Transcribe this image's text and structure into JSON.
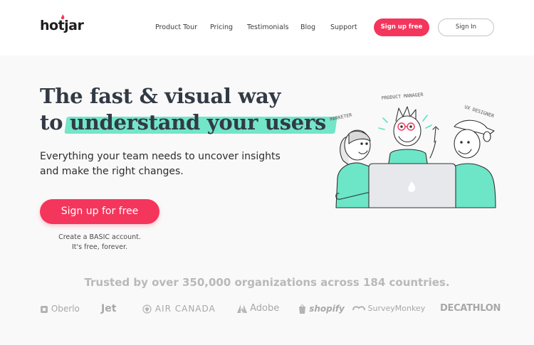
{
  "brand": {
    "logo_text": "hotjar"
  },
  "nav": {
    "items": [
      {
        "label": "Product Tour"
      },
      {
        "label": "Pricing"
      },
      {
        "label": "Testimonials"
      },
      {
        "label": "Blog"
      },
      {
        "label": "Support"
      }
    ],
    "signup_label": "Sign up free",
    "signin_label": "Sign In"
  },
  "hero": {
    "headline_line1": "The fast & visual way",
    "headline_to": "to",
    "headline_highlight": "understand your users",
    "subtitle": "Everything your team needs to uncover insights and make the right changes.",
    "cta_label": "Sign up for free",
    "cta_note_line1": "Create a BASIC account.",
    "cta_note_line2": "It's free, forever."
  },
  "illustration": {
    "labels": {
      "marketer": "MARKETER",
      "product_manager": "PRODUCT MANAGER",
      "ux_designer": "UX DESIGNER"
    }
  },
  "trusted": {
    "text": "Trusted by over 350,000 organizations across 184 countries.",
    "logos": [
      {
        "name": "Oberlo"
      },
      {
        "name": "Jet"
      },
      {
        "name": "AIR CANADA"
      },
      {
        "name": "Adobe"
      },
      {
        "name": "shopify"
      },
      {
        "name": "SurveyMonkey"
      },
      {
        "name": "DECATHLON"
      }
    ]
  },
  "colors": {
    "accent": "#f4365c",
    "highlight": "#5ce3c0",
    "text": "#323a45",
    "muted": "#a8a8a8"
  }
}
